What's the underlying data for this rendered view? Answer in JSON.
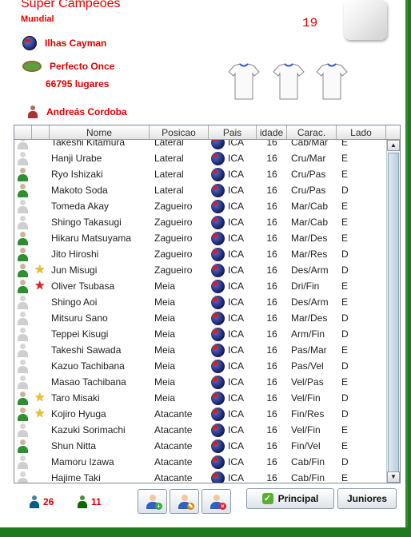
{
  "header": {
    "title": "Super Campeões",
    "subtitle": "Mundial",
    "count": "19"
  },
  "team": {
    "country": "Ilhas Cayman",
    "stadium": "Perfecto Once",
    "capacity": "66795 lugares",
    "coach": "Andreás Cordoba"
  },
  "table": {
    "columns": [
      "",
      "",
      "Nome",
      "Posicao",
      "Pais",
      "idade",
      "Carac.",
      "Lado"
    ],
    "rows": [
      {
        "icon": "gray",
        "star": "",
        "name": "Takeshi Kitamura",
        "pos": "Lateral",
        "pais": "ICA",
        "age": "16",
        "carac": "Cab/Mar",
        "lado": "E"
      },
      {
        "icon": "gray",
        "star": "",
        "name": "Hanji Urabe",
        "pos": "Lateral",
        "pais": "ICA",
        "age": "16",
        "carac": "Cru/Mar",
        "lado": "E"
      },
      {
        "icon": "green",
        "star": "",
        "name": "Ryo Ishizaki",
        "pos": "Lateral",
        "pais": "ICA",
        "age": "16",
        "carac": "Cru/Pas",
        "lado": "E"
      },
      {
        "icon": "green",
        "star": "",
        "name": "Makoto Soda",
        "pos": "Lateral",
        "pais": "ICA",
        "age": "16",
        "carac": "Cru/Pas",
        "lado": "D"
      },
      {
        "icon": "gray",
        "star": "",
        "name": "Tomeda Akay",
        "pos": "Zagueiro",
        "pais": "ICA",
        "age": "16",
        "carac": "Mar/Cab",
        "lado": "E"
      },
      {
        "icon": "gray",
        "star": "",
        "name": "Shingo Takasugi",
        "pos": "Zagueiro",
        "pais": "ICA",
        "age": "16",
        "carac": "Mar/Cab",
        "lado": "E"
      },
      {
        "icon": "green",
        "star": "",
        "name": "Hikaru Matsuyama",
        "pos": "Zagueiro",
        "pais": "ICA",
        "age": "16",
        "carac": "Mar/Des",
        "lado": "E"
      },
      {
        "icon": "green",
        "star": "",
        "name": "Jito Hiroshi",
        "pos": "Zagueiro",
        "pais": "ICA",
        "age": "16",
        "carac": "Mar/Res",
        "lado": "D"
      },
      {
        "icon": "green",
        "star": "gold",
        "name": "Jun Misugi",
        "pos": "Zagueiro",
        "pais": "ICA",
        "age": "16",
        "carac": "Des/Arm",
        "lado": "D"
      },
      {
        "icon": "green",
        "star": "red",
        "name": "Oliver Tsubasa",
        "pos": "Meia",
        "pais": "ICA",
        "age": "16",
        "carac": "Dri/Fin",
        "lado": "E"
      },
      {
        "icon": "gray",
        "star": "",
        "name": "Shingo Aoi",
        "pos": "Meia",
        "pais": "ICA",
        "age": "16",
        "carac": "Des/Arm",
        "lado": "E"
      },
      {
        "icon": "gray",
        "star": "",
        "name": "Mitsuru Sano",
        "pos": "Meia",
        "pais": "ICA",
        "age": "16",
        "carac": "Mar/Des",
        "lado": "D"
      },
      {
        "icon": "gray",
        "star": "",
        "name": "Teppei Kisugi",
        "pos": "Meia",
        "pais": "ICA",
        "age": "16",
        "carac": "Arm/Fin",
        "lado": "D"
      },
      {
        "icon": "gray",
        "star": "",
        "name": "Takeshi Sawada",
        "pos": "Meia",
        "pais": "ICA",
        "age": "16",
        "carac": "Pas/Mar",
        "lado": "E"
      },
      {
        "icon": "gray",
        "star": "",
        "name": "Kazuo Tachibana",
        "pos": "Meia",
        "pais": "ICA",
        "age": "16",
        "carac": "Pas/Vel",
        "lado": "D"
      },
      {
        "icon": "gray",
        "star": "",
        "name": "Masao Tachibana",
        "pos": "Meia",
        "pais": "ICA",
        "age": "16",
        "carac": "Vel/Pas",
        "lado": "E"
      },
      {
        "icon": "green",
        "star": "gold",
        "name": "Taro Misaki",
        "pos": "Meia",
        "pais": "ICA",
        "age": "16",
        "carac": "Vel/Fin",
        "lado": "D"
      },
      {
        "icon": "green",
        "star": "gold",
        "name": "Kojiro Hyuga",
        "pos": "Atacante",
        "pais": "ICA",
        "age": "16",
        "carac": "Fin/Res",
        "lado": "D"
      },
      {
        "icon": "gray",
        "star": "",
        "name": "Kazuki Sorimachi",
        "pos": "Atacante",
        "pais": "ICA",
        "age": "16",
        "carac": "Vel/Fin",
        "lado": "E"
      },
      {
        "icon": "green",
        "star": "",
        "name": "Shun Nitta",
        "pos": "Atacante",
        "pais": "ICA",
        "age": "16",
        "carac": "Fin/Vel",
        "lado": "E"
      },
      {
        "icon": "gray",
        "star": "",
        "name": "Mamoru Izawa",
        "pos": "Atacante",
        "pais": "ICA",
        "age": "16",
        "carac": "Cab/Fin",
        "lado": "D"
      },
      {
        "icon": "gray",
        "star": "",
        "name": "Hajime Taki",
        "pos": "Atacante",
        "pais": "ICA",
        "age": "16",
        "carac": "Cab/Fin",
        "lado": "E"
      }
    ]
  },
  "footer": {
    "total_players": "26",
    "main_players": "11",
    "principal_label": "Principal",
    "juniores_label": "Juniores"
  }
}
